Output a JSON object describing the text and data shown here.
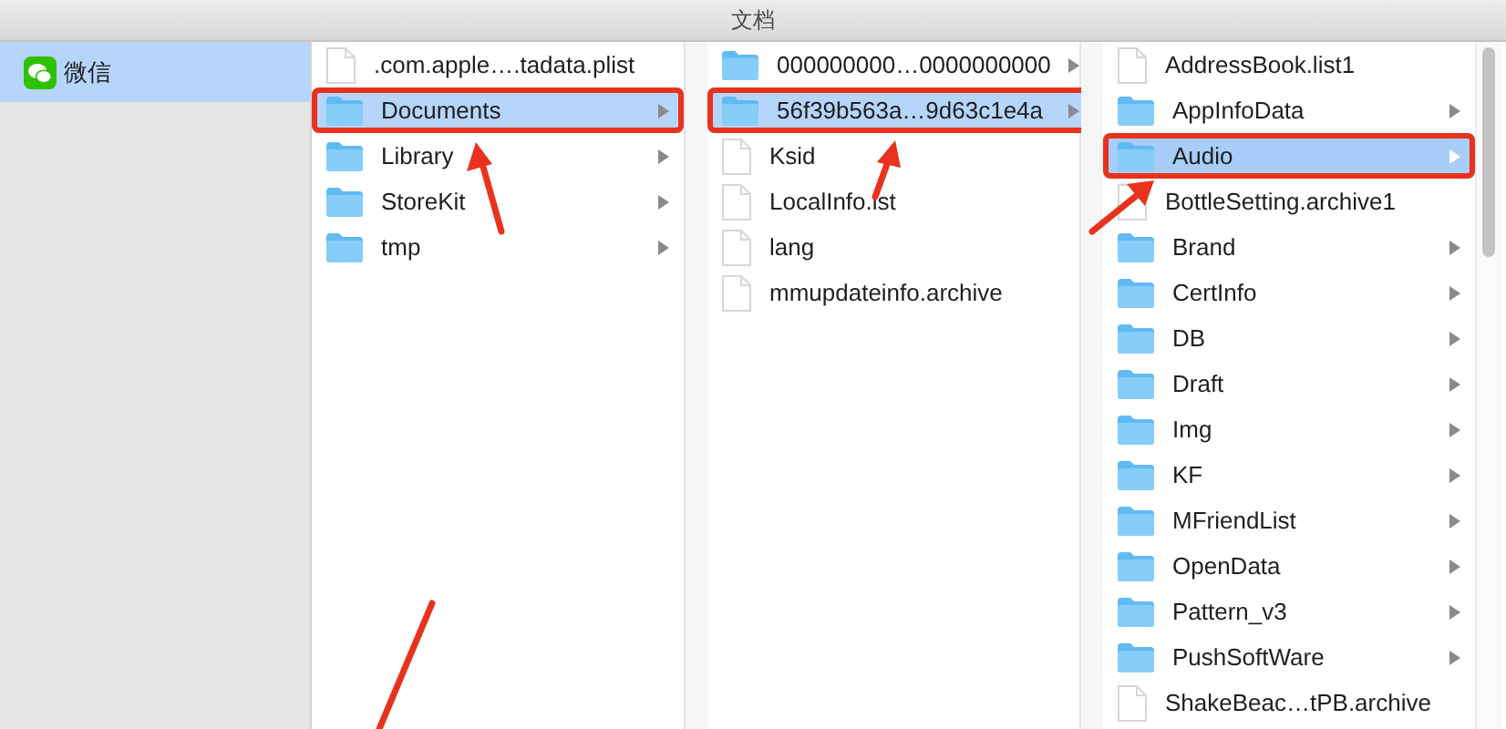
{
  "window": {
    "title": "文档"
  },
  "sidebar": {
    "items": [
      {
        "label": "微信",
        "selected": true
      }
    ]
  },
  "columns": [
    {
      "items": [
        {
          "name": ".com.apple….tadata.plist",
          "kind": "file",
          "selected": false,
          "annotated": false
        },
        {
          "name": "Documents",
          "kind": "folder",
          "selected": true,
          "annotated": true
        },
        {
          "name": "Library",
          "kind": "folder",
          "selected": false,
          "annotated": false
        },
        {
          "name": "StoreKit",
          "kind": "folder",
          "selected": false,
          "annotated": false
        },
        {
          "name": "tmp",
          "kind": "folder",
          "selected": false,
          "annotated": false
        }
      ]
    },
    {
      "items": [
        {
          "name": "000000000…0000000000",
          "kind": "folder",
          "selected": false,
          "annotated": false
        },
        {
          "name": "56f39b563a…9d63c1e4a",
          "kind": "folder",
          "selected": true,
          "annotated": true
        },
        {
          "name": "Ksid",
          "kind": "file",
          "selected": false,
          "annotated": false
        },
        {
          "name": "LocalInfo.lst",
          "kind": "file",
          "selected": false,
          "annotated": false
        },
        {
          "name": "lang",
          "kind": "file",
          "selected": false,
          "annotated": false
        },
        {
          "name": "mmupdateinfo.archive",
          "kind": "file",
          "selected": false,
          "annotated": false
        }
      ]
    },
    {
      "items": [
        {
          "name": "AddressBook.list1",
          "kind": "file",
          "selected": false,
          "annotated": false
        },
        {
          "name": "AppInfoData",
          "kind": "folder",
          "selected": false,
          "annotated": false
        },
        {
          "name": "Audio",
          "kind": "folder",
          "selected": true,
          "annotated": true
        },
        {
          "name": "BottleSetting.archive1",
          "kind": "file",
          "selected": false,
          "annotated": false
        },
        {
          "name": "Brand",
          "kind": "folder",
          "selected": false,
          "annotated": false
        },
        {
          "name": "CertInfo",
          "kind": "folder",
          "selected": false,
          "annotated": false
        },
        {
          "name": "DB",
          "kind": "folder",
          "selected": false,
          "annotated": false
        },
        {
          "name": "Draft",
          "kind": "folder",
          "selected": false,
          "annotated": false
        },
        {
          "name": "Img",
          "kind": "folder",
          "selected": false,
          "annotated": false
        },
        {
          "name": "KF",
          "kind": "folder",
          "selected": false,
          "annotated": false
        },
        {
          "name": "MFriendList",
          "kind": "folder",
          "selected": false,
          "annotated": false
        },
        {
          "name": "OpenData",
          "kind": "folder",
          "selected": false,
          "annotated": false
        },
        {
          "name": "Pattern_v3",
          "kind": "folder",
          "selected": false,
          "annotated": false
        },
        {
          "name": "PushSoftWare",
          "kind": "folder",
          "selected": false,
          "annotated": false
        },
        {
          "name": "ShakeBeac…tPB.archive",
          "kind": "file",
          "selected": false,
          "annotated": false
        }
      ]
    }
  ]
}
